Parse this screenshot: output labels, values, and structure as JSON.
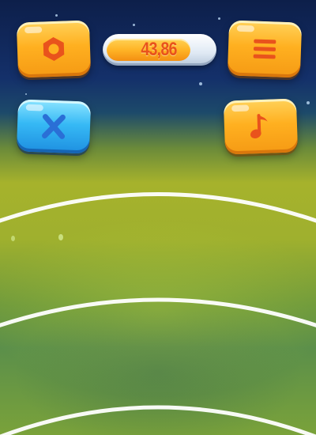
{
  "hud": {
    "score_value": "43,86",
    "score_fill_fraction": 0.79
  },
  "buttons": {
    "settings": {
      "icon": "nut-icon"
    },
    "menu": {
      "icon": "menu-icon"
    },
    "close": {
      "icon": "close-icon"
    },
    "music": {
      "icon": "music-note-icon"
    }
  },
  "colors": {
    "button_orange": "#ffb020",
    "button_blue": "#36b9f5",
    "icon_red": "#e9531c",
    "icon_blue": "#2a6fd6",
    "track_line": "#ffffff",
    "sky_top": "#0d1f4a",
    "field": "#a6b22c"
  }
}
